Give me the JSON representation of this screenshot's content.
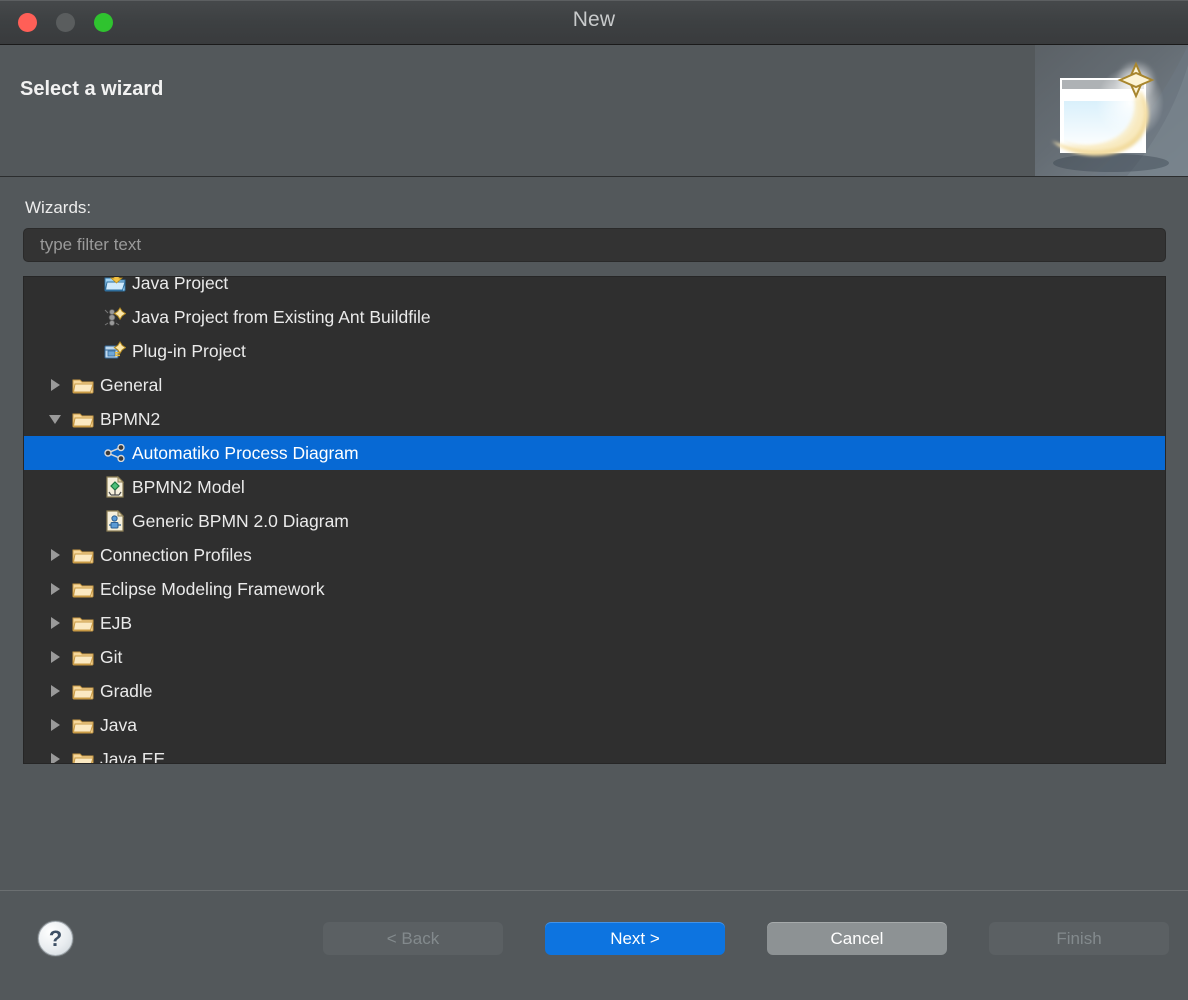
{
  "window": {
    "title": "New",
    "traffic_lights": [
      "close-button",
      "minimize-button",
      "maximize-button"
    ]
  },
  "header": {
    "title": "Select a wizard",
    "banner_icon": "wizard-sparkle-window-icon"
  },
  "body": {
    "wizards_label": "Wizards:",
    "filter": {
      "value": "",
      "placeholder": "type filter text"
    },
    "tree": [
      {
        "label": "Java Project",
        "icon": "java-project-icon",
        "twisty": "none",
        "level": 1,
        "selected": false,
        "clipped_top": true
      },
      {
        "label": "Java Project from Existing Ant Buildfile",
        "icon": "ant-buildfile-icon",
        "twisty": "none",
        "level": 1,
        "selected": false
      },
      {
        "label": "Plug-in Project",
        "icon": "plugin-project-icon",
        "twisty": "none",
        "level": 1,
        "selected": false
      },
      {
        "label": "General",
        "icon": "folder-icon",
        "twisty": "collapsed",
        "level": 0,
        "selected": false
      },
      {
        "label": "BPMN2",
        "icon": "folder-icon",
        "twisty": "expanded",
        "level": 0,
        "selected": false
      },
      {
        "label": "Automatiko Process Diagram",
        "icon": "share-network-icon",
        "twisty": "none",
        "level": 1,
        "selected": true
      },
      {
        "label": "BPMN2 Model",
        "icon": "bpmn2-model-icon",
        "twisty": "none",
        "level": 1,
        "selected": false
      },
      {
        "label": "Generic BPMN 2.0 Diagram",
        "icon": "generic-bpmn-diagram-icon",
        "twisty": "none",
        "level": 1,
        "selected": false
      },
      {
        "label": "Connection Profiles",
        "icon": "folder-icon",
        "twisty": "collapsed",
        "level": 0,
        "selected": false
      },
      {
        "label": "Eclipse Modeling Framework",
        "icon": "folder-icon",
        "twisty": "collapsed",
        "level": 0,
        "selected": false
      },
      {
        "label": "EJB",
        "icon": "folder-icon",
        "twisty": "collapsed",
        "level": 0,
        "selected": false
      },
      {
        "label": "Git",
        "icon": "folder-icon",
        "twisty": "collapsed",
        "level": 0,
        "selected": false
      },
      {
        "label": "Gradle",
        "icon": "folder-icon",
        "twisty": "collapsed",
        "level": 0,
        "selected": false
      },
      {
        "label": "Java",
        "icon": "folder-icon",
        "twisty": "collapsed",
        "level": 0,
        "selected": false
      },
      {
        "label": "Java EE",
        "icon": "folder-icon",
        "twisty": "collapsed",
        "level": 0,
        "selected": false,
        "clipped_bottom": true
      }
    ]
  },
  "footer": {
    "help_glyph": "?",
    "buttons": [
      {
        "label": "< Back",
        "state": "disabled",
        "name": "back-button"
      },
      {
        "label": "Next >",
        "state": "primary",
        "name": "next-button"
      },
      {
        "label": "Cancel",
        "state": "normal",
        "name": "cancel-button"
      },
      {
        "label": "Finish",
        "state": "disabled",
        "name": "finish-button"
      }
    ]
  },
  "colors": {
    "dialog_bg": "#53585b",
    "titlebar_bg": "#3d4042",
    "tree_bg": "#2f2f2f",
    "selection_blue": "#0769d4",
    "primary_button": "#0d74e0",
    "normal_button": "#8d9294",
    "disabled_button": "#5b6063",
    "close_light": "#ff5f57",
    "minimize_light": "#5a5d5e",
    "maximize_light": "#2fc32f"
  }
}
